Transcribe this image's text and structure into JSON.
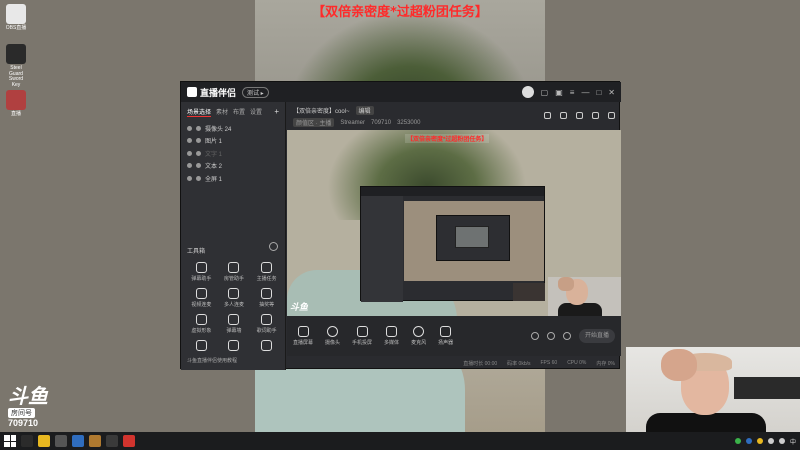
{
  "overlay_banner": "【双倍亲密度*过超粉团任务】",
  "desktop_icons": [
    {
      "label": "OBS直播",
      "color": "#e8e8e8"
    },
    {
      "label": "Steel Guard Sword Key",
      "color": "#2a2a2a"
    },
    {
      "label": "直播",
      "color": "#b04040"
    }
  ],
  "app": {
    "name": "直播伴侣",
    "version_badge": "测试 ▸",
    "tabs": [
      "场景选择",
      "素材",
      "布置",
      "设置"
    ],
    "sources": [
      {
        "label": "摄像头 24",
        "dim": false
      },
      {
        "label": "图片 1",
        "dim": false
      },
      {
        "label": "文字 1",
        "dim": true
      },
      {
        "label": "文本 2",
        "dim": false
      },
      {
        "label": "全屏 1",
        "dim": false
      }
    ],
    "tools_heading": "工具箱",
    "tools": [
      "弹幕助手",
      "房管助手",
      "主播任务",
      "视频连麦",
      "多人连麦",
      "抽奖等",
      "虚拟形象",
      "弹幕墙",
      "歌词助手",
      "",
      "",
      ""
    ],
    "left_footer": "斗鱼直播伴侣使用教程",
    "room_title": "【双倍亲密度】cool~",
    "room_tag": "编辑",
    "room_meta": [
      "颜值区 · 主播",
      "Streamer",
      "709710",
      "3253000"
    ],
    "preview_banner": "【双倍亲密度*过超粉团任务】",
    "preview_watermark": "斗鱼",
    "bottom_controls": [
      "直播屏幕",
      "摄像头",
      "手机投屏",
      "多媒体",
      "麦克风",
      "扬声器"
    ],
    "live_button": "开始直播",
    "status_items": [
      "直播时长 00:00",
      "码率 0kb/s",
      "FPS 60",
      "CPU 0%",
      "内存 0%"
    ]
  },
  "watermark": {
    "logo": "斗鱼",
    "sub": "房间号",
    "room_id": "709710"
  },
  "taskbar": {
    "right_text": "中"
  },
  "colors": {
    "banner_red": "#ff2a2a",
    "app_bg": "#2a2b2f",
    "accent_red": "#e33333"
  }
}
